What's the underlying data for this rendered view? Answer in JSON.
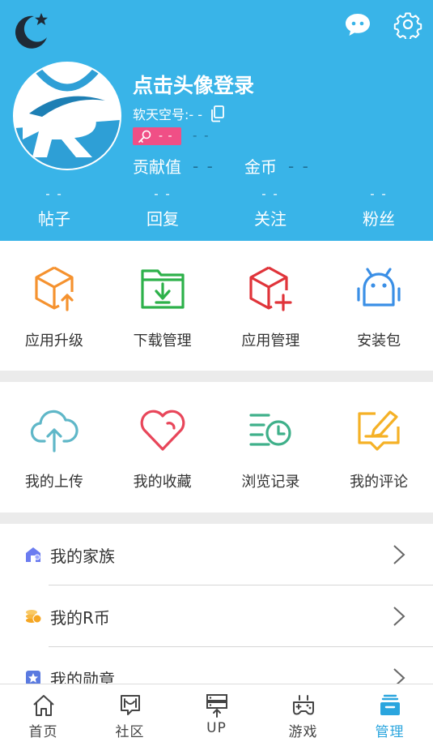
{
  "header": {
    "login_prompt": "点击头像登录",
    "account_label": "软天空号:- -",
    "level_value": "- -",
    "level_extra": "- -",
    "contribution_label": "贡献值",
    "contribution_value": "- -",
    "coins_label": "金币",
    "coins_value": "- -",
    "stats": [
      {
        "value": "- -",
        "label": "帖子"
      },
      {
        "value": "- -",
        "label": "回复"
      },
      {
        "value": "- -",
        "label": "关注"
      },
      {
        "value": "- -",
        "label": "粉丝"
      }
    ],
    "icons": [
      "moon-star-icon",
      "chat-bubble-icon",
      "settings-gear-icon",
      "copy-icon"
    ]
  },
  "grid_top": [
    {
      "label": "应用升级",
      "icon": "app-upgrade-icon",
      "color": "#f5922f"
    },
    {
      "label": "下载管理",
      "icon": "download-folder-icon",
      "color": "#2db14a"
    },
    {
      "label": "应用管理",
      "icon": "app-manage-icon",
      "color": "#e0343a"
    },
    {
      "label": "安装包",
      "icon": "android-package-icon",
      "color": "#3a8fe6"
    }
  ],
  "grid_bottom": [
    {
      "label": "我的上传",
      "icon": "cloud-upload-icon",
      "color": "#5fb7c8"
    },
    {
      "label": "我的收藏",
      "icon": "heart-icon",
      "color": "#e8465a"
    },
    {
      "label": "浏览记录",
      "icon": "history-clock-icon",
      "color": "#3fb08a"
    },
    {
      "label": "我的评论",
      "icon": "comment-edit-icon",
      "color": "#f5b126"
    }
  ],
  "list": [
    {
      "label": "我的家族",
      "icon": "family-house-icon"
    },
    {
      "label": "我的R币",
      "icon": "coin-stack-icon"
    },
    {
      "label": "我的勋章",
      "icon": "medal-star-icon"
    }
  ],
  "bottom_nav": [
    {
      "label": "首页",
      "icon": "home-icon",
      "active": false
    },
    {
      "label": "社区",
      "icon": "community-icon",
      "active": false
    },
    {
      "label": "UP",
      "icon": "upload-server-icon",
      "active": false
    },
    {
      "label": "游戏",
      "icon": "gamepad-icon",
      "active": false
    },
    {
      "label": "管理",
      "icon": "manage-tray-icon",
      "active": true
    }
  ],
  "colors": {
    "header_bg": "#39b4e8",
    "accent": "#2aa5de",
    "level_badge": "#f04f86",
    "divider_gray": "#ebebeb"
  }
}
